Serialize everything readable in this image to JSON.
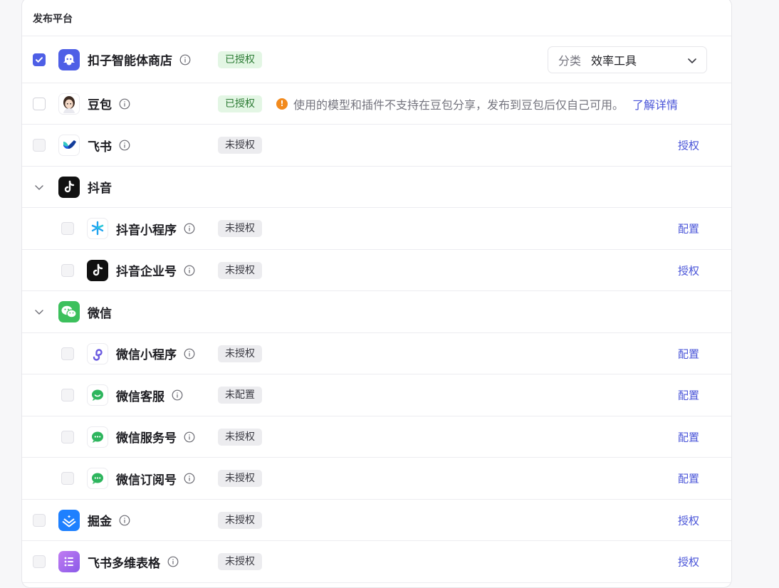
{
  "header": {
    "title": "发布平台"
  },
  "category_select": {
    "label": "分类",
    "value": "效率工具"
  },
  "notice": {
    "text": "使用的模型和插件不支持在豆包分享，发布到豆包后仅自己可用。",
    "link": "了解详情",
    "icon": "!"
  },
  "rows": [
    {
      "id": "coze",
      "name": "扣子智能体商店",
      "badge": "已授权",
      "checked": true,
      "icon": "coze-store-icon"
    },
    {
      "id": "doubao",
      "name": "豆包",
      "badge": "已授权",
      "icon": "doubao-avatar-icon"
    },
    {
      "id": "feishu",
      "name": "飞书",
      "badge": "未授权",
      "action": "授权",
      "icon": "feishu-icon"
    },
    {
      "id": "douyin",
      "name": "抖音",
      "icon": "douyin-icon"
    },
    {
      "id": "douyin-mini",
      "name": "抖音小程序",
      "badge": "未授权",
      "action": "配置",
      "icon": "douyin-miniprogram-icon"
    },
    {
      "id": "douyin-biz",
      "name": "抖音企业号",
      "badge": "未授权",
      "action": "授权",
      "icon": "douyin-icon"
    },
    {
      "id": "wechat",
      "name": "微信",
      "icon": "wechat-icon"
    },
    {
      "id": "wechat-mini",
      "name": "微信小程序",
      "badge": "未授权",
      "action": "配置",
      "icon": "wechat-miniprogram-icon"
    },
    {
      "id": "wechat-kf",
      "name": "微信客服",
      "badge": "未配置",
      "action": "配置",
      "icon": "wechat-service-icon"
    },
    {
      "id": "wechat-fwh",
      "name": "微信服务号",
      "badge": "未授权",
      "action": "配置",
      "icon": "wechat-chat-icon"
    },
    {
      "id": "wechat-dyh",
      "name": "微信订阅号",
      "badge": "未授权",
      "action": "配置",
      "icon": "wechat-chat-icon"
    },
    {
      "id": "juejin",
      "name": "掘金",
      "badge": "未授权",
      "action": "授权",
      "icon": "juejin-icon"
    },
    {
      "id": "feishu-bitable",
      "name": "飞书多维表格",
      "badge": "未授权",
      "action": "授权",
      "icon": "feishu-bitable-icon"
    }
  ]
}
